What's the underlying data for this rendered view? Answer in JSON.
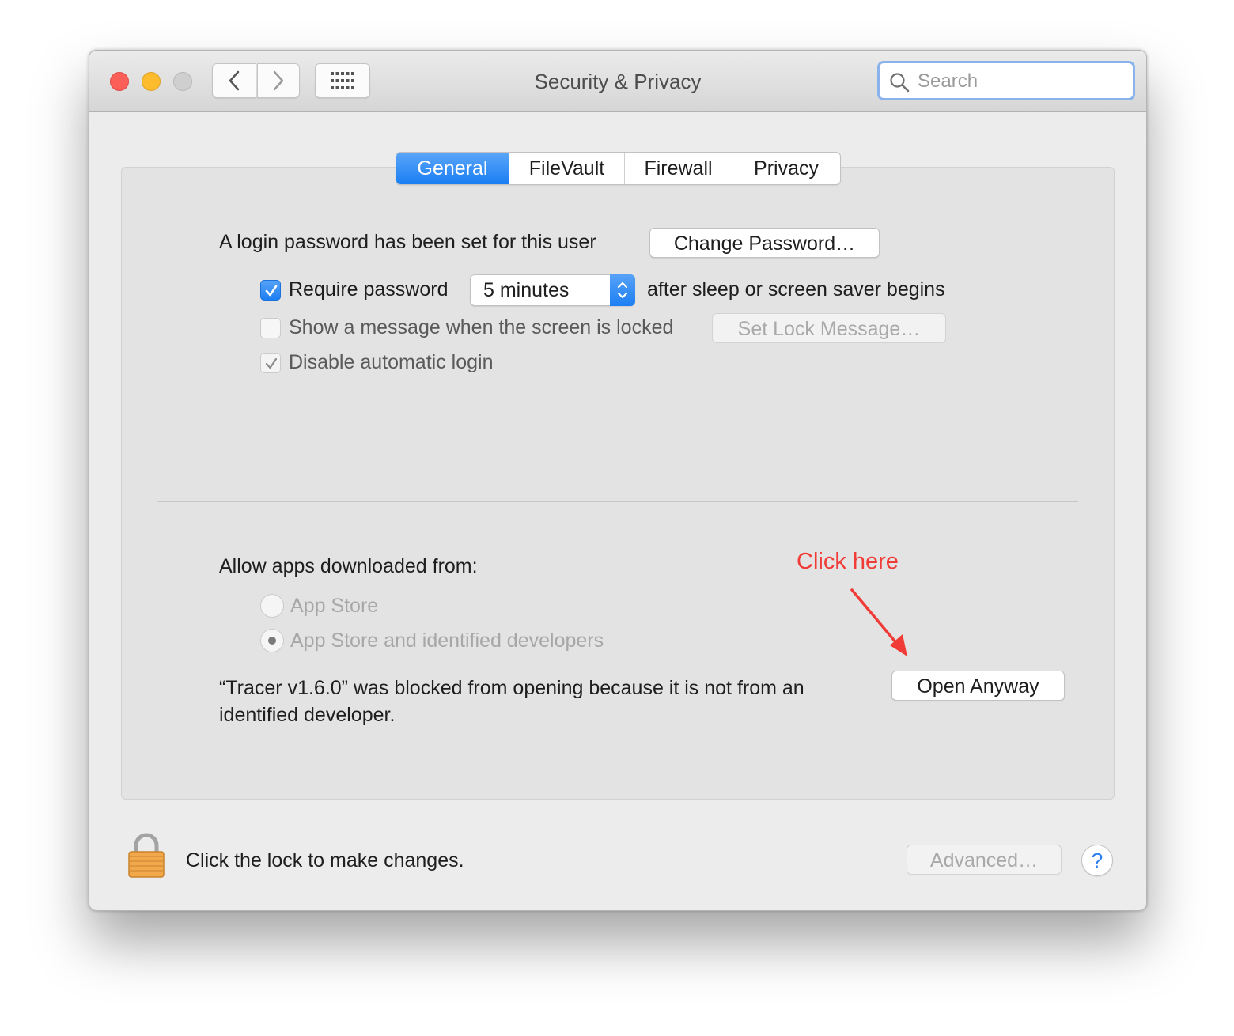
{
  "window": {
    "title": "Security & Privacy"
  },
  "toolbar": {
    "back_icon": "chevron-left-icon",
    "forward_icon": "chevron-right-icon",
    "show_all_icon": "grid-icon"
  },
  "search": {
    "placeholder": "Search",
    "value": ""
  },
  "tabs": [
    {
      "label": "General",
      "active": true
    },
    {
      "label": "FileVault",
      "active": false
    },
    {
      "label": "Firewall",
      "active": false
    },
    {
      "label": "Privacy",
      "active": false
    }
  ],
  "general": {
    "login_password_text": "A login password has been set for this user",
    "change_password_button": "Change Password…",
    "require_password": {
      "checked": true,
      "label": "Require password",
      "delay_value": "5 minutes",
      "suffix": "after sleep or screen saver begins"
    },
    "show_message": {
      "checked": false,
      "label": "Show a message when the screen is locked",
      "button": "Set Lock Message…"
    },
    "disable_auto_login": {
      "checked": true,
      "label": "Disable automatic login"
    }
  },
  "gatekeeper": {
    "heading": "Allow apps downloaded from:",
    "options": [
      {
        "label": "App Store",
        "selected": false
      },
      {
        "label": "App Store and identified developers",
        "selected": true
      }
    ],
    "blocked_message_line1": "“Tracer v1.6.0” was blocked from opening because it is not from an",
    "blocked_message_line2": "identified developer.",
    "open_anyway_button": "Open Anyway"
  },
  "annotation": {
    "text": "Click here",
    "color": "#f03b36"
  },
  "footer": {
    "lock_text": "Click the lock to make changes.",
    "advanced_button": "Advanced…",
    "help_button": "?"
  },
  "colors": {
    "accent": "#1a7ef3",
    "close": "#fc5f57",
    "minimize": "#fdbc2e",
    "zoom_disabled": "#cfcfcf"
  }
}
